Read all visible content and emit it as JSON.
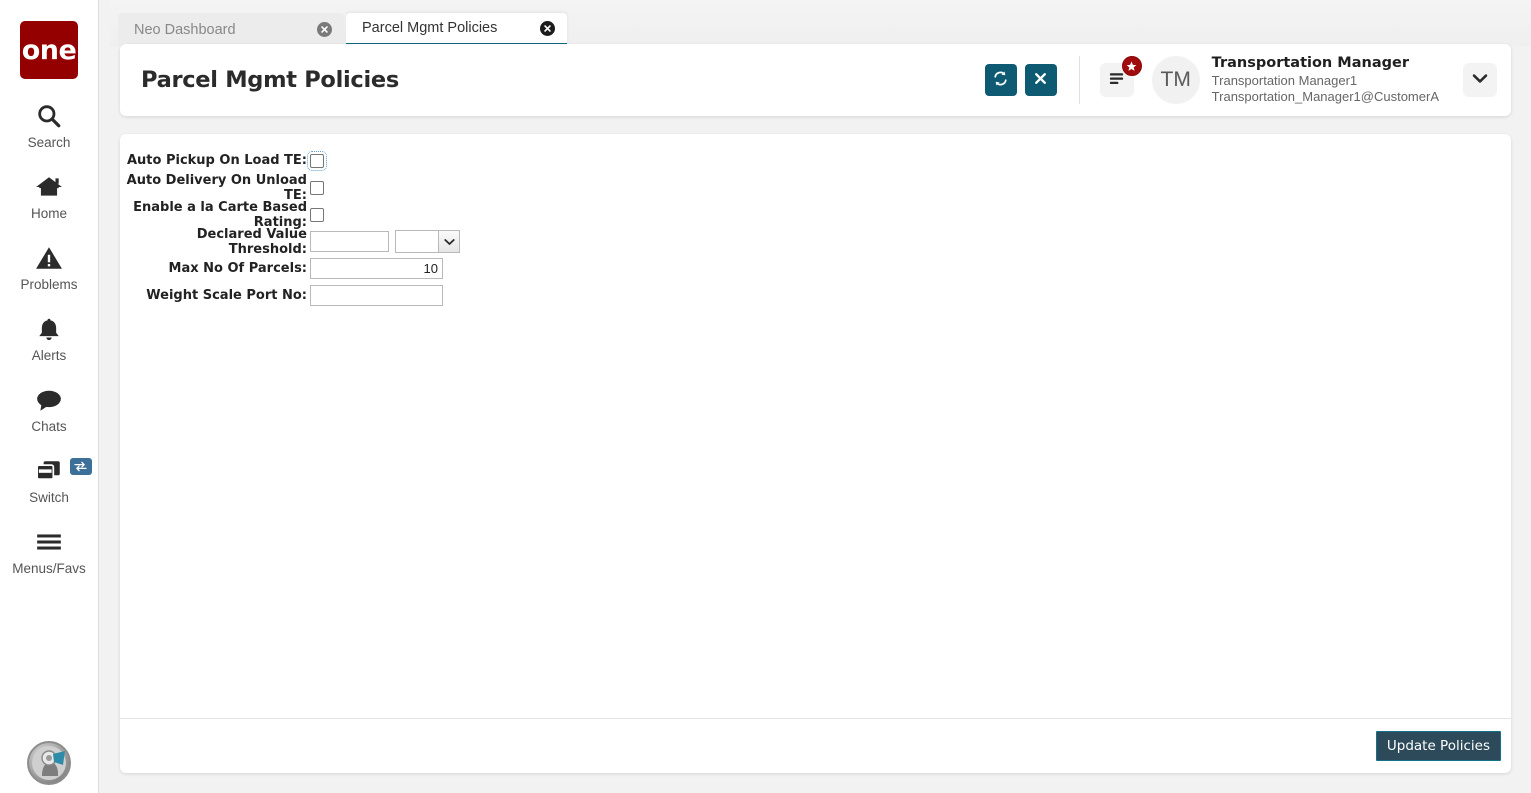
{
  "sidebar": {
    "logo_text": "one",
    "items": [
      {
        "label": "Search",
        "icon": "search-icon"
      },
      {
        "label": "Home",
        "icon": "home-icon"
      },
      {
        "label": "Problems",
        "icon": "warning-triangle-icon"
      },
      {
        "label": "Alerts",
        "icon": "bell-icon"
      },
      {
        "label": "Chats",
        "icon": "chat-bubble-icon"
      },
      {
        "label": "Switch",
        "icon": "windows-stack-icon",
        "badge_icon": "swap-arrows-icon"
      },
      {
        "label": "Menus/Favs",
        "icon": "hamburger-icon"
      }
    ],
    "assistant_avatar_icon": "assistant-head-icon"
  },
  "tabs": [
    {
      "label": "Neo Dashboard",
      "active": false
    },
    {
      "label": "Parcel Mgmt Policies",
      "active": true
    }
  ],
  "header": {
    "title": "Parcel Mgmt Policies",
    "refresh_icon": "refresh-icon",
    "close_icon": "close-x-icon",
    "menu_icon": "list-menu-icon",
    "menu_badge_icon": "star-badge-icon",
    "chevron_icon": "chevron-down-icon",
    "user": {
      "avatar_initials": "TM",
      "role": "Transportation Manager",
      "name": "Transportation Manager1",
      "email": "Transportation_Manager1@CustomerA"
    }
  },
  "form": {
    "rows": [
      {
        "label": "Auto Pickup On Load TE:",
        "type": "checkbox",
        "checked": false,
        "focused": true
      },
      {
        "label": "Auto Delivery On Unload TE:",
        "type": "checkbox",
        "checked": false,
        "focused": false
      },
      {
        "label": "Enable a la Carte Based Rating:",
        "type": "checkbox",
        "checked": false,
        "focused": false
      },
      {
        "label": "Declared Value Threshold:",
        "type": "text-with-select",
        "value": "",
        "select_value": ""
      },
      {
        "label": "Max No Of Parcels:",
        "type": "number",
        "value": "10"
      },
      {
        "label": "Weight Scale Port No:",
        "type": "text",
        "value": ""
      }
    ]
  },
  "footer": {
    "update_label": "Update Policies"
  },
  "colors": {
    "brand_red": "#940000",
    "teal_action": "#0d5a72",
    "tab_active_underline": "#13697f",
    "badge_red": "#a00b0b",
    "update_btn_bg": "#2c4a5a",
    "update_btn_border": "#137288",
    "switch_badge_blue": "#3d7099"
  }
}
